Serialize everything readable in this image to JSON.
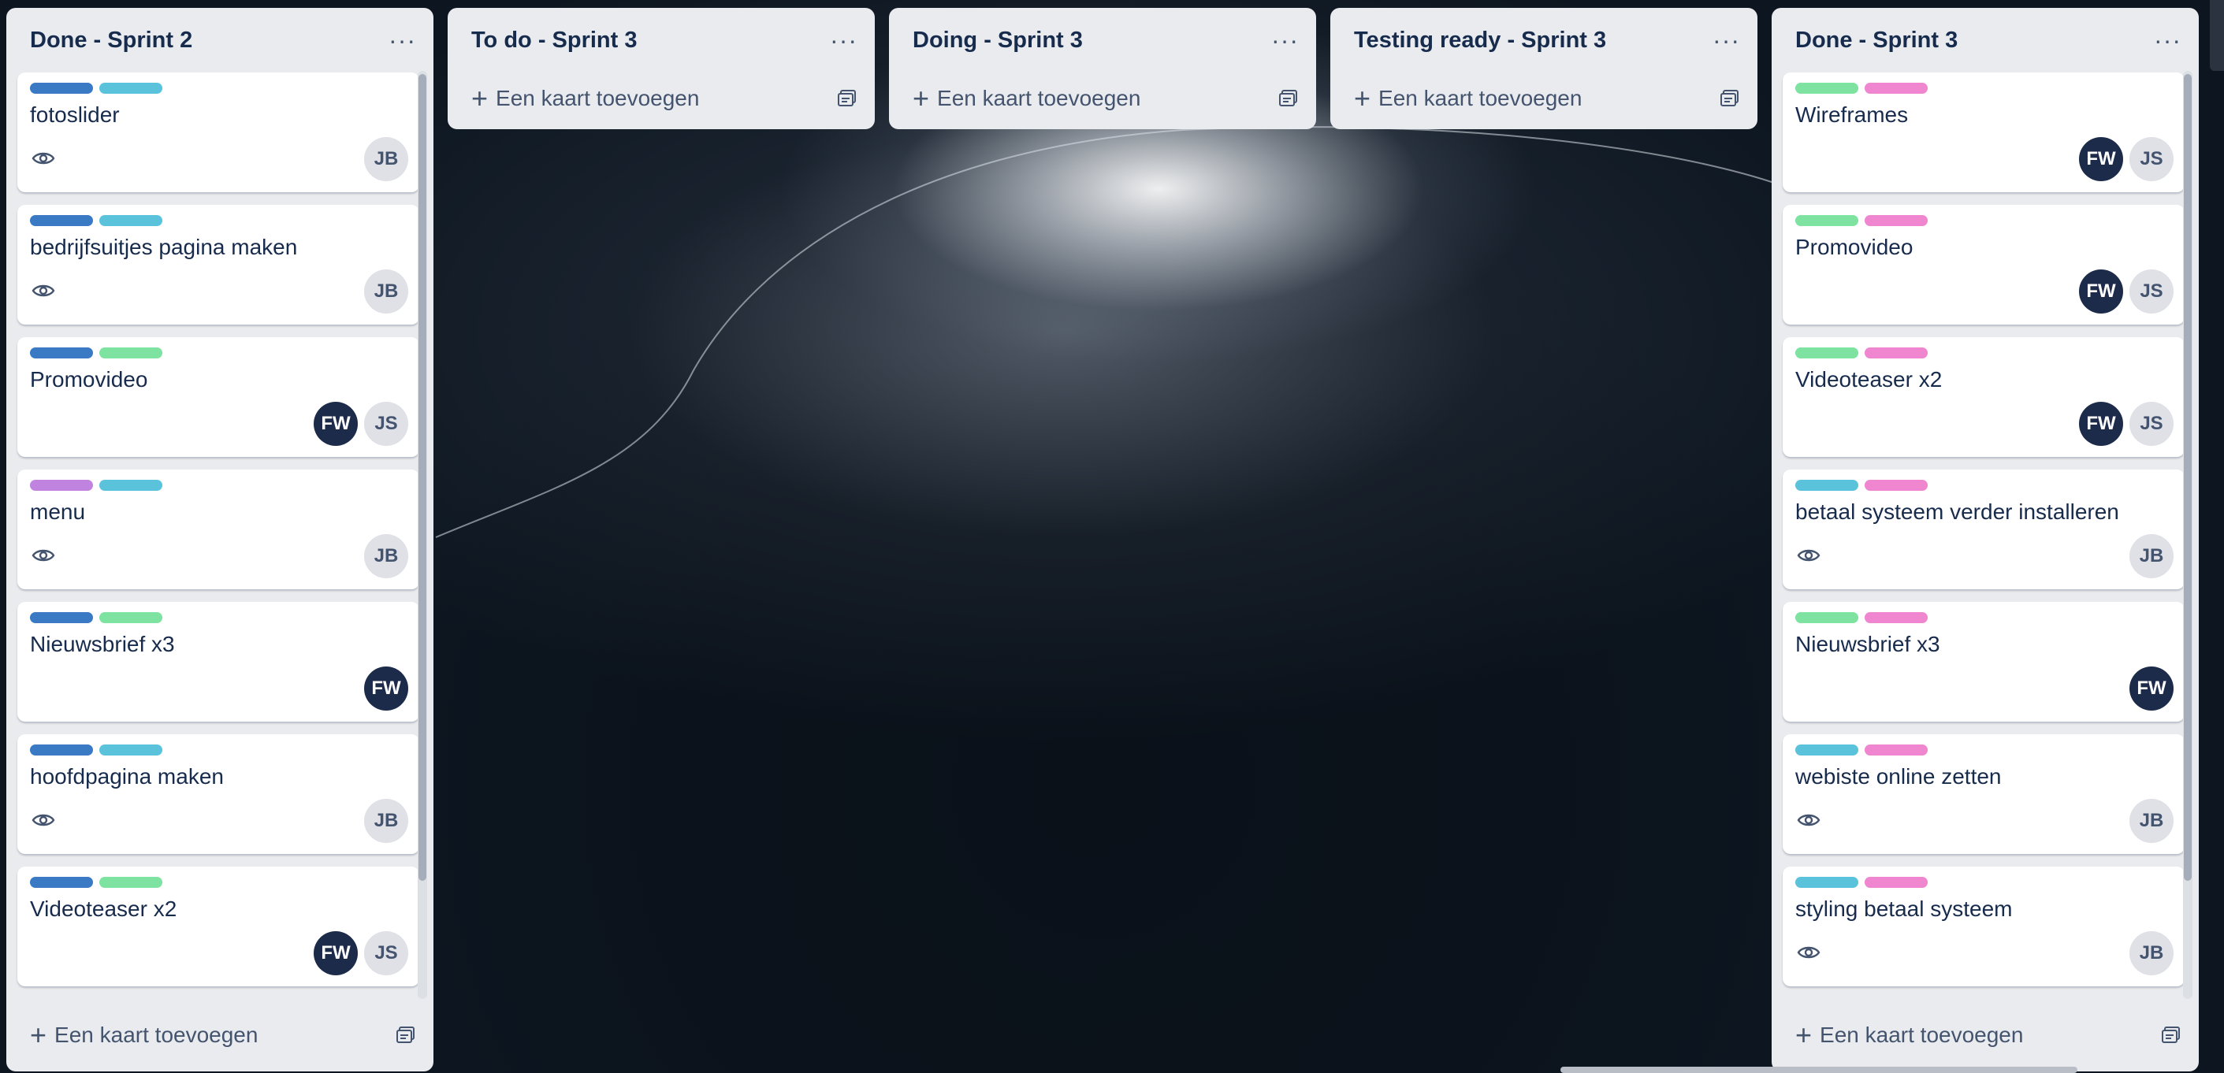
{
  "lists": [
    {
      "title": "Done - Sprint 2",
      "add_label": "Een kaart toevoegen",
      "cards": [
        {
          "title": "fotoslider",
          "labels": [
            "#3a79c3",
            "#5ac2db"
          ],
          "watch": true,
          "members": [
            "JB"
          ]
        },
        {
          "title": "bedrijfsuitjes pagina maken",
          "labels": [
            "#3a79c3",
            "#5ac2db"
          ],
          "watch": true,
          "members": [
            "JB"
          ]
        },
        {
          "title": "Promovideo",
          "labels": [
            "#3a79c3",
            "#7ee2a0"
          ],
          "watch": false,
          "members": [
            "FW",
            "JS"
          ]
        },
        {
          "title": "menu",
          "labels": [
            "#c084e0",
            "#5ac2db"
          ],
          "watch": true,
          "members": [
            "JB"
          ]
        },
        {
          "title": "Nieuwsbrief x3",
          "labels": [
            "#3a79c3",
            "#7ee2a0"
          ],
          "watch": false,
          "members": [
            "FW"
          ]
        },
        {
          "title": "hoofdpagina maken",
          "labels": [
            "#3a79c3",
            "#5ac2db"
          ],
          "watch": true,
          "members": [
            "JB"
          ]
        },
        {
          "title": "Videoteaser x2",
          "labels": [
            "#3a79c3",
            "#7ee2a0"
          ],
          "watch": false,
          "members": [
            "FW",
            "JS"
          ]
        }
      ]
    },
    {
      "title": "To do - Sprint 3",
      "add_label": "Een kaart toevoegen",
      "cards": []
    },
    {
      "title": "Doing - Sprint 3",
      "add_label": "Een kaart toevoegen",
      "cards": []
    },
    {
      "title": "Testing ready - Sprint 3",
      "add_label": "Een kaart toevoegen",
      "cards": []
    },
    {
      "title": "Done - Sprint 3",
      "add_label": "Een kaart toevoegen",
      "cards": [
        {
          "title": "Wireframes",
          "labels": [
            "#7ee2a0",
            "#ef86cf"
          ],
          "watch": false,
          "members": [
            "FW",
            "JS"
          ]
        },
        {
          "title": "Promovideo",
          "labels": [
            "#7ee2a0",
            "#ef86cf"
          ],
          "watch": false,
          "members": [
            "FW",
            "JS"
          ]
        },
        {
          "title": "Videoteaser x2",
          "labels": [
            "#7ee2a0",
            "#ef86cf"
          ],
          "watch": false,
          "members": [
            "FW",
            "JS"
          ]
        },
        {
          "title": "betaal systeem verder installeren",
          "labels": [
            "#5ac2db",
            "#ef86cf"
          ],
          "watch": true,
          "members": [
            "JB"
          ]
        },
        {
          "title": "Nieuwsbrief x3",
          "labels": [
            "#7ee2a0",
            "#ef86cf"
          ],
          "watch": false,
          "members": [
            "FW"
          ]
        },
        {
          "title": "webiste online zetten",
          "labels": [
            "#5ac2db",
            "#ef86cf"
          ],
          "watch": true,
          "members": [
            "JB"
          ]
        },
        {
          "title": "styling betaal systeem",
          "labels": [
            "#5ac2db",
            "#ef86cf"
          ],
          "watch": true,
          "members": [
            "JB"
          ]
        }
      ]
    }
  ],
  "icons": {
    "more": "more-horizontal-icon",
    "add": "plus-icon",
    "template": "card-template-icon",
    "watch": "eye-icon"
  },
  "colors": {
    "avatar_dark": "#1c2b4a",
    "avatar_light": "#dfe1e6",
    "list_bg": "#e9ebee"
  }
}
